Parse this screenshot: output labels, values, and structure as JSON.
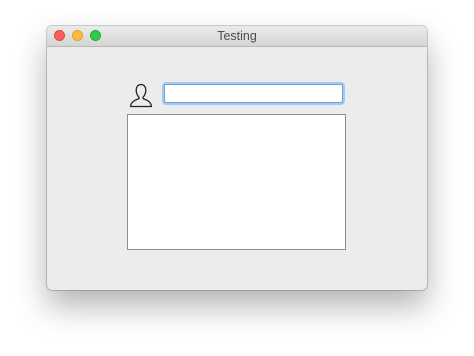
{
  "window": {
    "title": "Testing"
  },
  "form": {
    "username_icon": "user-silhouette-icon",
    "username_value": "",
    "body_value": ""
  },
  "colors": {
    "close": "#fc605c",
    "minimize": "#fdbc40",
    "zoom": "#34c84a",
    "focus_ring": "#a6c8f2"
  }
}
